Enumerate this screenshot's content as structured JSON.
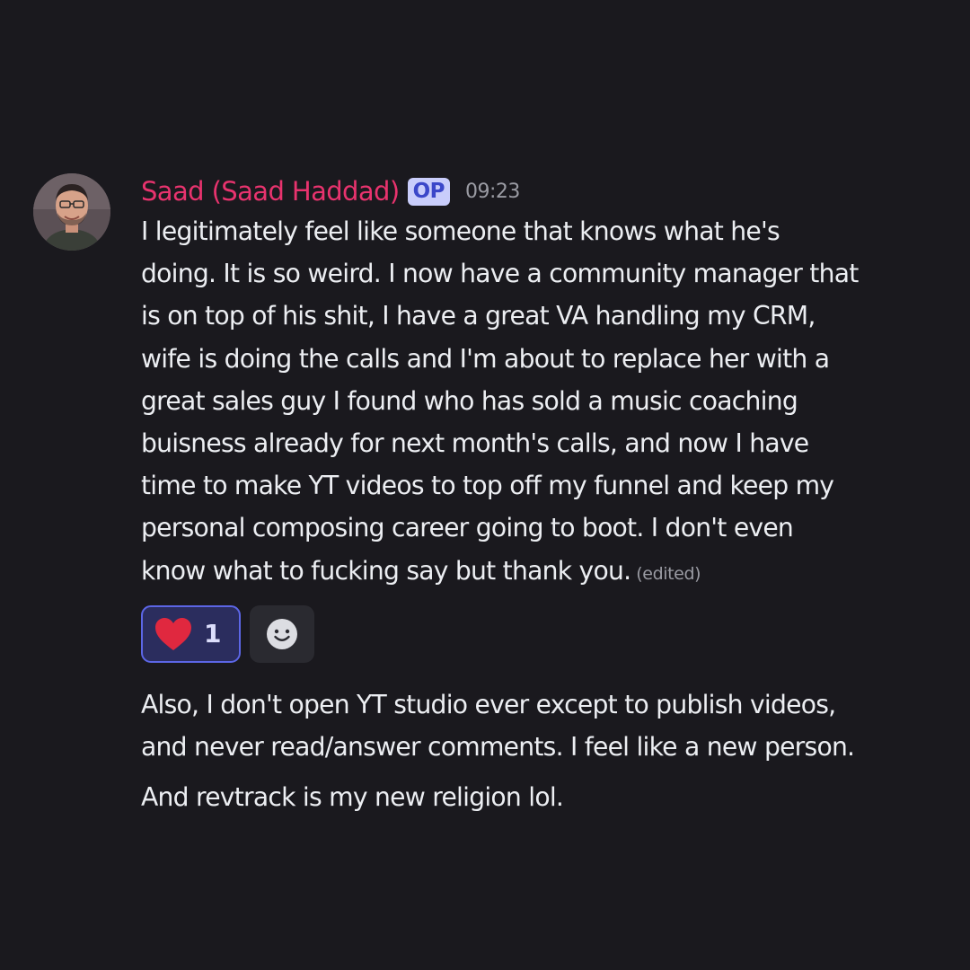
{
  "message": {
    "author": "Saad (Saad Haddad)",
    "badge": "OP",
    "timestamp": "09:23",
    "lines": [
      "I legitimately feel like someone that knows what he's",
      "doing. It is so weird. I now have a community manager that",
      "is on top of his shit, I have a great VA handling my CRM,",
      "wife is doing the calls and I'm about to replace her with a",
      "great sales guy I found who has sold a music coaching",
      "buisness already for next month's calls, and now I have",
      "time to make YT videos to top off my funnel and keep my",
      "personal composing career going to boot. I don't even",
      "know what to fucking say but thank you."
    ],
    "edited_label": "(edited)",
    "reactions": [
      {
        "emoji": "heart-icon",
        "count": "1",
        "selected": true
      }
    ],
    "followups": [
      {
        "lines": [
          "Also, I don't open YT studio ever except to publish videos,",
          "and never read/answer comments. I feel like a new person."
        ]
      },
      {
        "lines": [
          "And revtrack is my new religion lol."
        ]
      }
    ]
  },
  "colors": {
    "background": "#1a191e",
    "author": "#e8336e",
    "badge_bg": "#c9cdfb",
    "badge_text": "#3b47c9",
    "reaction_bg": "#2b2d5e",
    "reaction_border": "#5c66e6",
    "heart": "#e0283f"
  }
}
